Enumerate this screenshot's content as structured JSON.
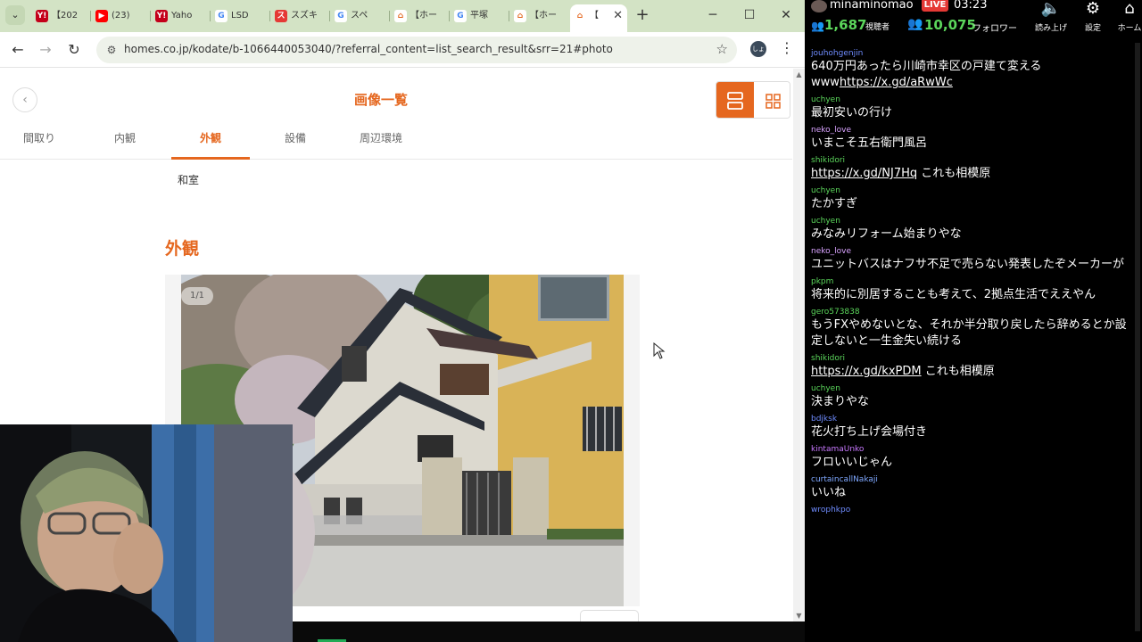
{
  "browser": {
    "tabs": [
      {
        "icon": "Y!",
        "label": "【202",
        "color": "#c4001a",
        "fgcolor": "#ffffff"
      },
      {
        "icon": "▶",
        "label": "(23)",
        "color": "#ff0000",
        "fgcolor": "#ffffff"
      },
      {
        "icon": "Y!",
        "label": "Yaho",
        "color": "#c4001a",
        "fgcolor": "#ffffff"
      },
      {
        "icon": "G",
        "label": "LSD",
        "color": "#ffffff",
        "fgcolor": "#4285f4"
      },
      {
        "icon": "ス",
        "label": "スズキ",
        "color": "#e53935",
        "fgcolor": "#ffffff"
      },
      {
        "icon": "G",
        "label": "スペ",
        "color": "#ffffff",
        "fgcolor": "#4285f4"
      },
      {
        "icon": "⌂",
        "label": "【ホー",
        "color": "#ffffff",
        "fgcolor": "#e5671f"
      },
      {
        "icon": "G",
        "label": "平塚",
        "color": "#ffffff",
        "fgcolor": "#4285f4"
      },
      {
        "icon": "⌂",
        "label": "【ホー",
        "color": "#ffffff",
        "fgcolor": "#e5671f"
      },
      {
        "icon": "⌂",
        "label": "【",
        "color": "#ffffff",
        "fgcolor": "#e5671f"
      }
    ],
    "new_tab": "+",
    "window_controls": {
      "minimize": "─",
      "maximize": "☐",
      "close": "✕"
    },
    "nav": {
      "back": "←",
      "forward": "→",
      "reload": "↻"
    },
    "url": "homes.co.jp/kodate/b-1066440053040/?referral_content=list_search_result&srr=21#photo",
    "bookmark_star": "☆",
    "profile_initials": "しょ",
    "menu": "⋮"
  },
  "page": {
    "back": "‹",
    "title": "画像一覧",
    "tabs": [
      {
        "label": "間取り",
        "active": false
      },
      {
        "label": "内観",
        "active": false
      },
      {
        "label": "外観",
        "active": true
      },
      {
        "label": "設備",
        "active": false
      },
      {
        "label": "周辺環境",
        "active": false
      }
    ],
    "room_label": "和室",
    "section_title": "外観",
    "photo_counter": "1/1",
    "accent_color": "#e5671f"
  },
  "stream": {
    "channel": "minaminomao",
    "live_label": "LIVE",
    "elapsed": "03:23",
    "viewers": "1,687",
    "viewers_label": "視聴者",
    "followers": "10,075",
    "followers_label": "フォロワー",
    "controls": [
      {
        "icon": "🔈",
        "label": "読み上げ"
      },
      {
        "icon": "⚙",
        "label": "設定"
      },
      {
        "icon": "⌂",
        "label": "ホーム"
      }
    ],
    "messages": [
      {
        "user": "jouhohgenjin",
        "color": "#6f8cff",
        "segments": [
          {
            "text": "640万円あったら川崎市幸区の戸建て変えるwww",
            "link": false
          },
          {
            "text": "https://x.gd/aRwWc",
            "link": true
          }
        ]
      },
      {
        "user": "uchyen",
        "color": "#5bd65b",
        "segments": [
          {
            "text": "最初安いの行け",
            "link": false
          }
        ]
      },
      {
        "user": "neko_love",
        "color": "#d9a3ff",
        "segments": [
          {
            "text": "いまこそ五右衛門風呂",
            "link": false
          }
        ]
      },
      {
        "user": "shikidori",
        "color": "#5bd65b",
        "segments": [
          {
            "text": "https://x.gd/NJ7Hq",
            "link": true
          },
          {
            "text": " これも相模原",
            "link": false
          }
        ]
      },
      {
        "user": "uchyen",
        "color": "#5bd65b",
        "segments": [
          {
            "text": "たかすぎ",
            "link": false
          }
        ]
      },
      {
        "user": "uchyen",
        "color": "#5bd65b",
        "segments": [
          {
            "text": "みなみリフォーム始まりやな",
            "link": false
          }
        ]
      },
      {
        "user": "neko_love",
        "color": "#d9a3ff",
        "segments": [
          {
            "text": "ユニットバスはナフサ不足で売らない発表したぞメーカーが",
            "link": false
          }
        ]
      },
      {
        "user": "pkpm",
        "color": "#5bd65b",
        "segments": [
          {
            "text": "将来的に別居することも考えて、2拠点生活でええやん",
            "link": false
          }
        ]
      },
      {
        "user": "gero573838",
        "color": "#5bd65b",
        "segments": [
          {
            "text": "もうFXやめないとな、それか半分取り戻したら辞めるとか設定しないと一生金失い続ける",
            "link": false
          }
        ]
      },
      {
        "user": "shikidori",
        "color": "#5bd65b",
        "segments": [
          {
            "text": "https://x.gd/kxPDM",
            "link": true
          },
          {
            "text": " これも相模原",
            "link": false
          }
        ]
      },
      {
        "user": "uchyen",
        "color": "#5bd65b",
        "segments": [
          {
            "text": "決まりやな",
            "link": false
          }
        ]
      },
      {
        "user": "bdjksk",
        "color": "#6f8cff",
        "segments": [
          {
            "text": "花火打ち上げ会場付き",
            "link": false
          }
        ]
      },
      {
        "user": "kintamaUnko",
        "color": "#c878ff",
        "segments": [
          {
            "text": "フロいいじゃん",
            "link": false
          }
        ]
      },
      {
        "user": "curtaincallNakaji",
        "color": "#7fa8ff",
        "segments": [
          {
            "text": "いいね",
            "link": false
          }
        ]
      },
      {
        "user": "wrophkpo",
        "color": "#6f8cff",
        "segments": []
      }
    ]
  }
}
